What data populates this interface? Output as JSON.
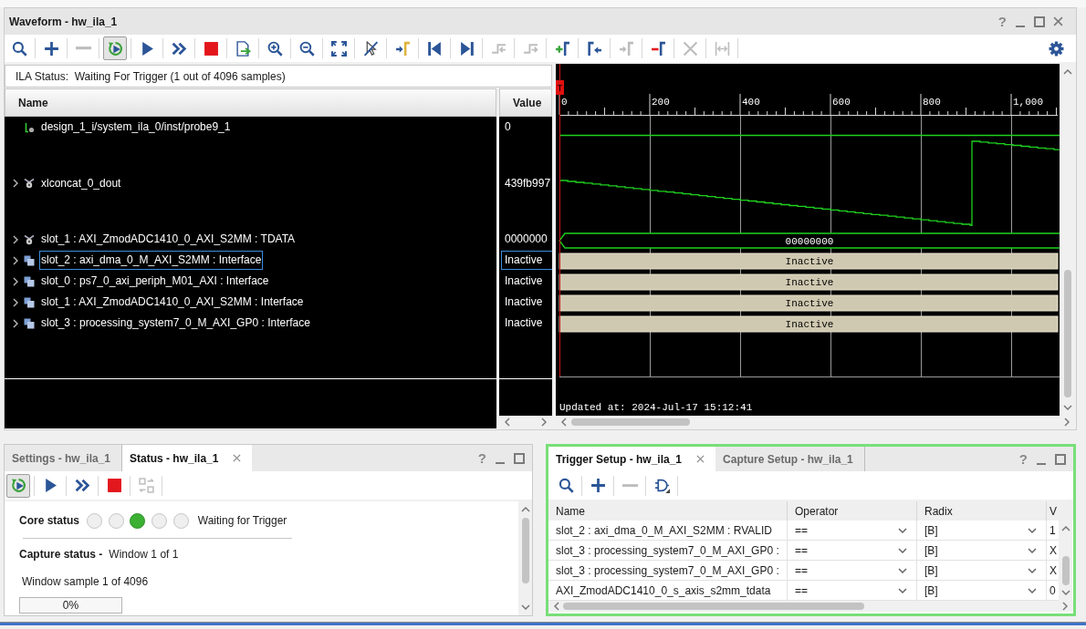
{
  "waveform": {
    "title": "Waveform - hw_ila_1",
    "help": "?",
    "toolbar": [
      {
        "kind": "search",
        "disabled": false,
        "active": false
      },
      {
        "kind": "add",
        "disabled": false,
        "active": false
      },
      {
        "kind": "remove",
        "disabled": true,
        "active": false
      },
      {
        "kind": "immediate",
        "disabled": false,
        "active": true
      },
      {
        "kind": "run",
        "disabled": false,
        "active": false
      },
      {
        "kind": "repeat",
        "disabled": false,
        "active": false
      },
      {
        "kind": "stop",
        "disabled": false,
        "active": false
      },
      {
        "kind": "export",
        "disabled": false,
        "active": false
      },
      {
        "kind": "zoom_in",
        "disabled": false,
        "active": false
      },
      {
        "kind": "zoom_out",
        "disabled": false,
        "active": false
      },
      {
        "kind": "zoom_fit",
        "disabled": false,
        "active": false
      },
      {
        "kind": "cursor",
        "disabled": false,
        "active": false
      },
      {
        "kind": "goto_marker",
        "disabled": false,
        "active": false
      },
      {
        "kind": "first",
        "disabled": false,
        "active": false
      },
      {
        "kind": "last",
        "disabled": false,
        "active": false
      },
      {
        "kind": "prev_edge",
        "disabled": true,
        "active": false
      },
      {
        "kind": "next_edge",
        "disabled": true,
        "active": false
      },
      {
        "kind": "add_marker",
        "disabled": false,
        "active": false
      },
      {
        "kind": "prev_marker",
        "disabled": false,
        "active": false
      },
      {
        "kind": "next_marker",
        "disabled": true,
        "active": false
      },
      {
        "kind": "del_marker",
        "disabled": false,
        "active": false
      },
      {
        "kind": "del_all",
        "disabled": true,
        "active": false
      },
      {
        "kind": "measure",
        "disabled": true,
        "active": false
      },
      {
        "kind": "settings",
        "disabled": false,
        "active": false
      }
    ],
    "ila_status": "ILA Status:  Waiting For Trigger (1 out of 4096 samples)",
    "columns": [
      "Name",
      "Value"
    ],
    "signals": [
      {
        "name": "design_1_i/system_ila_0/inst/probe9_1",
        "value": "0",
        "kind": "bit",
        "expandable": false,
        "selected": false
      },
      {
        "name": "xlconcat_0_dout",
        "value": "439fb997",
        "kind": "analog",
        "expandable": true,
        "selected": false
      },
      {
        "name": "slot_1 : AXI_ZmodADC1410_0_AXI_S2MM : TDATA",
        "value": "0000000",
        "kind": "bus",
        "expandable": true,
        "selected": false,
        "trace_text": "00000000"
      },
      {
        "name": "slot_2 : axi_dma_0_M_AXI_S2MM : Interface",
        "value": "Inactive",
        "kind": "interface",
        "expandable": true,
        "selected": true,
        "trace_text": "Inactive"
      },
      {
        "name": "slot_0 : ps7_0_axi_periph_M01_AXI : Interface",
        "value": "Inactive",
        "kind": "interface",
        "expandable": true,
        "selected": false,
        "trace_text": "Inactive"
      },
      {
        "name": "slot_1 : AXI_ZmodADC1410_0_AXI_S2MM : Interface",
        "value": "Inactive",
        "kind": "interface",
        "expandable": true,
        "selected": false,
        "trace_text": "Inactive"
      },
      {
        "name": "slot_3 : processing_system7_0_M_AXI_GP0 : Interface",
        "value": "Inactive",
        "kind": "interface",
        "expandable": true,
        "selected": false,
        "trace_text": "Inactive"
      }
    ],
    "trigger_marker": "T",
    "ruler_labels": [
      "0",
      "200",
      "400",
      "600",
      "800",
      "1,000"
    ],
    "updated": "Updated at: 2024-Jul-17 15:12:41"
  },
  "status_panel": {
    "tabs": [
      {
        "label": "Settings - hw_ila_1",
        "selected": false
      },
      {
        "label": "Status - hw_ila_1",
        "selected": true
      }
    ],
    "help": "?",
    "toolbar": [
      {
        "kind": "immediate",
        "disabled": false,
        "active": true
      },
      {
        "kind": "run",
        "disabled": false,
        "active": false
      },
      {
        "kind": "repeat",
        "disabled": false,
        "active": false
      },
      {
        "kind": "stop",
        "disabled": false,
        "active": false
      },
      {
        "kind": "sync",
        "disabled": true,
        "active": false
      }
    ],
    "core_status": {
      "label": "Core status",
      "lights": [
        {
          "on": false
        },
        {
          "on": false
        },
        {
          "on": true
        },
        {
          "on": false
        },
        {
          "on": false
        }
      ],
      "text": "Waiting for Trigger"
    },
    "capture_status": {
      "label": "Capture status -",
      "text": "Window 1 of 1"
    },
    "window_sample": "Window sample 1 of 4096",
    "progress": {
      "level": 0,
      "reading": "0%"
    }
  },
  "trigger_panel": {
    "focused": true,
    "tabs": [
      {
        "label": "Trigger Setup - hw_ila_1",
        "selected": true
      },
      {
        "label": "Capture Setup - hw_ila_1",
        "selected": false
      }
    ],
    "help": "?",
    "toolbar": [
      {
        "kind": "search",
        "disabled": false,
        "active": false
      },
      {
        "kind": "add",
        "disabled": false,
        "active": false
      },
      {
        "kind": "remove",
        "disabled": true,
        "active": false
      },
      {
        "kind": "gate",
        "disabled": false,
        "active": false
      }
    ],
    "columns": [
      "Name",
      "Operator",
      "Radix",
      "V"
    ],
    "rows": [
      {
        "name": "slot_2 : axi_dma_0_M_AXI_S2MM : RVALID",
        "operator": "==",
        "radix": "[B]",
        "column_4": "1"
      },
      {
        "name": "slot_3 : processing_system7_0_M_AXI_GP0 :",
        "operator": "==",
        "radix": "[B]",
        "column_4": "X"
      },
      {
        "name": "slot_3 : processing_system7_0_M_AXI_GP0 :",
        "operator": "==",
        "radix": "[B]",
        "column_4": "X"
      },
      {
        "name": "AXI_ZmodADC1410_0_s_axis_s2mm_tdata",
        "operator": "==",
        "radix": "[B]",
        "column_4": "0"
      }
    ]
  }
}
